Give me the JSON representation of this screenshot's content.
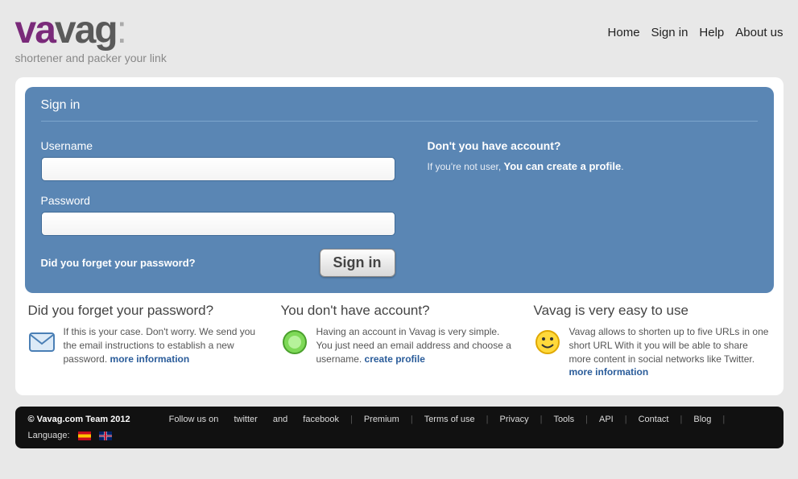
{
  "logo": {
    "part1": "va",
    "part2": "vag",
    "colon": ":"
  },
  "tagline": "shortener and packer your link",
  "nav": {
    "home": "Home",
    "signin": "Sign in",
    "help": "Help",
    "about": "About us"
  },
  "signin": {
    "title": "Sign in",
    "username_label": "Username",
    "password_label": "Password",
    "forgot": "Did you forget your password?",
    "button": "Sign in",
    "noaccount_title": "Don't you have account?",
    "noaccount_prefix": "If you're not user, ",
    "noaccount_bold": "You can create a profile",
    "noaccount_suffix": "."
  },
  "info": {
    "col1": {
      "title": "Did you forget your password?",
      "text": "If this is your case. Don't worry. We send you the email instructions to establish a new password. ",
      "link": "more information"
    },
    "col2": {
      "title": "You don't have account?",
      "text": "Having an account in Vavag is very simple. You just need an email address and choose a username. ",
      "link": "create profile"
    },
    "col3": {
      "title": "Vavag is very easy to use",
      "text": "Vavag allows to shorten up to five URLs in one short URL With it you will be able to share more content in social networks like Twitter. ",
      "link": "more information"
    }
  },
  "footer": {
    "copy": "© Vavag.com Team 2012",
    "follow": "Follow us on",
    "twitter": "twitter",
    "and": "and",
    "facebook": "facebook",
    "premium": "Premium",
    "terms": "Terms of use",
    "privacy": "Privacy",
    "tools": "Tools",
    "api": "API",
    "contact": "Contact",
    "blog": "Blog",
    "language": "Language:"
  }
}
